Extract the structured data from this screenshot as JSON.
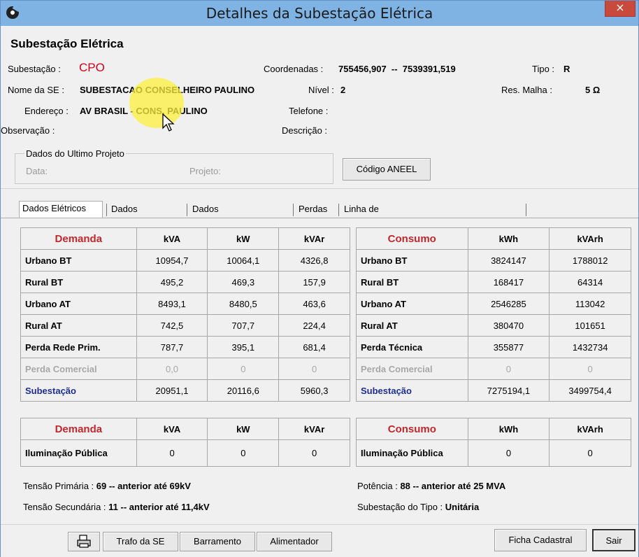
{
  "window": {
    "title": "Detalhes da Subestação Elétrica",
    "close_label": "×"
  },
  "header": {
    "heading": "Subestação Elétrica",
    "subestacao_label": "Subestação :",
    "subestacao_value": "CPO",
    "coordenadas_label": "Coordenadas :",
    "coordenadas_value": "755456,907  --  7539391,519",
    "tipo_label": "Tipo :",
    "tipo_value": "R",
    "nome_label": "Nome da SE :",
    "nome_value": "SUBESTACAO CONSELHEIRO PAULINO",
    "nivel_label": "Nível :",
    "nivel_value": "2",
    "resmalha_label": "Res. Malha :",
    "resmalha_value": "5 Ω",
    "endereco_label": "Endereço :",
    "endereco_value": "AV BRASIL - CONS. PAULINO",
    "telefone_label": "Telefone :",
    "observacao_label": "Observação :",
    "descricao_label": "Descrição :"
  },
  "projeto": {
    "group_label": "Dados do Ultimo Projeto",
    "data_label": "Data:",
    "projeto_label": "Projeto:",
    "codigo_button": "Código ANEEL"
  },
  "tabs": [
    "Dados Elétricos",
    "Dados Clientes",
    "Dados Corporativos",
    "Perdas",
    "Linha de Transmissão || Indicadores"
  ],
  "demanda": {
    "headers": [
      "Demanda",
      "kVA",
      "kW",
      "kVAr"
    ],
    "rows": [
      [
        "Urbano BT",
        "10954,7",
        "10064,1",
        "4326,8"
      ],
      [
        "Rural BT",
        "495,2",
        "469,3",
        "157,9"
      ],
      [
        "Urbano AT",
        "8493,1",
        "8480,5",
        "463,6"
      ],
      [
        "Rural AT",
        "742,5",
        "707,7",
        "224,4"
      ],
      [
        "Perda Rede Prim.",
        "787,7",
        "395,1",
        "681,4"
      ],
      [
        "Perda Comercial",
        "0,0",
        "0",
        "0"
      ]
    ],
    "total": [
      "Subestação",
      "20951,1",
      "20116,6",
      "5960,3"
    ]
  },
  "consumo": {
    "headers": [
      "Consumo",
      "kWh",
      "kVArh"
    ],
    "rows": [
      [
        "Urbano BT",
        "3824147",
        "1788012"
      ],
      [
        "Rural BT",
        "168417",
        "64314"
      ],
      [
        "Urbano AT",
        "2546285",
        "113042"
      ],
      [
        "Rural AT",
        "380470",
        "101651"
      ],
      [
        "Perda Técnica",
        "355877",
        "1432734"
      ],
      [
        "Perda Comercial",
        "0",
        "0"
      ]
    ],
    "total": [
      "Subestação",
      "7275194,1",
      "3499754,4"
    ]
  },
  "demanda_ip": {
    "headers": [
      "Demanda",
      "kVA",
      "kW",
      "kVAr"
    ],
    "row": [
      "Iluminação Pública",
      "0",
      "0",
      "0"
    ]
  },
  "consumo_ip": {
    "headers": [
      "Consumo",
      "kWh",
      "kVArh"
    ],
    "row": [
      "Iluminação Pública",
      "0",
      "0"
    ]
  },
  "footer": {
    "tensao_prim_label": "Tensão Primária :",
    "tensao_prim_value": "69 -- anterior até 69kV",
    "tensao_sec_label": "Tensão Secundária :",
    "tensao_sec_value": "11 -- anterior até 11,4kV",
    "potencia_label": "Potência :",
    "potencia_value": "88 -- anterior até 25 MVA",
    "tipo_label": "Subestação do Tipo :",
    "tipo_value": "Unitária"
  },
  "buttons": {
    "trafo": "Trafo da SE",
    "barramento": "Barramento",
    "alimentador": "Alimentador",
    "ficha": "Ficha Cadastral",
    "sair": "Sair"
  }
}
